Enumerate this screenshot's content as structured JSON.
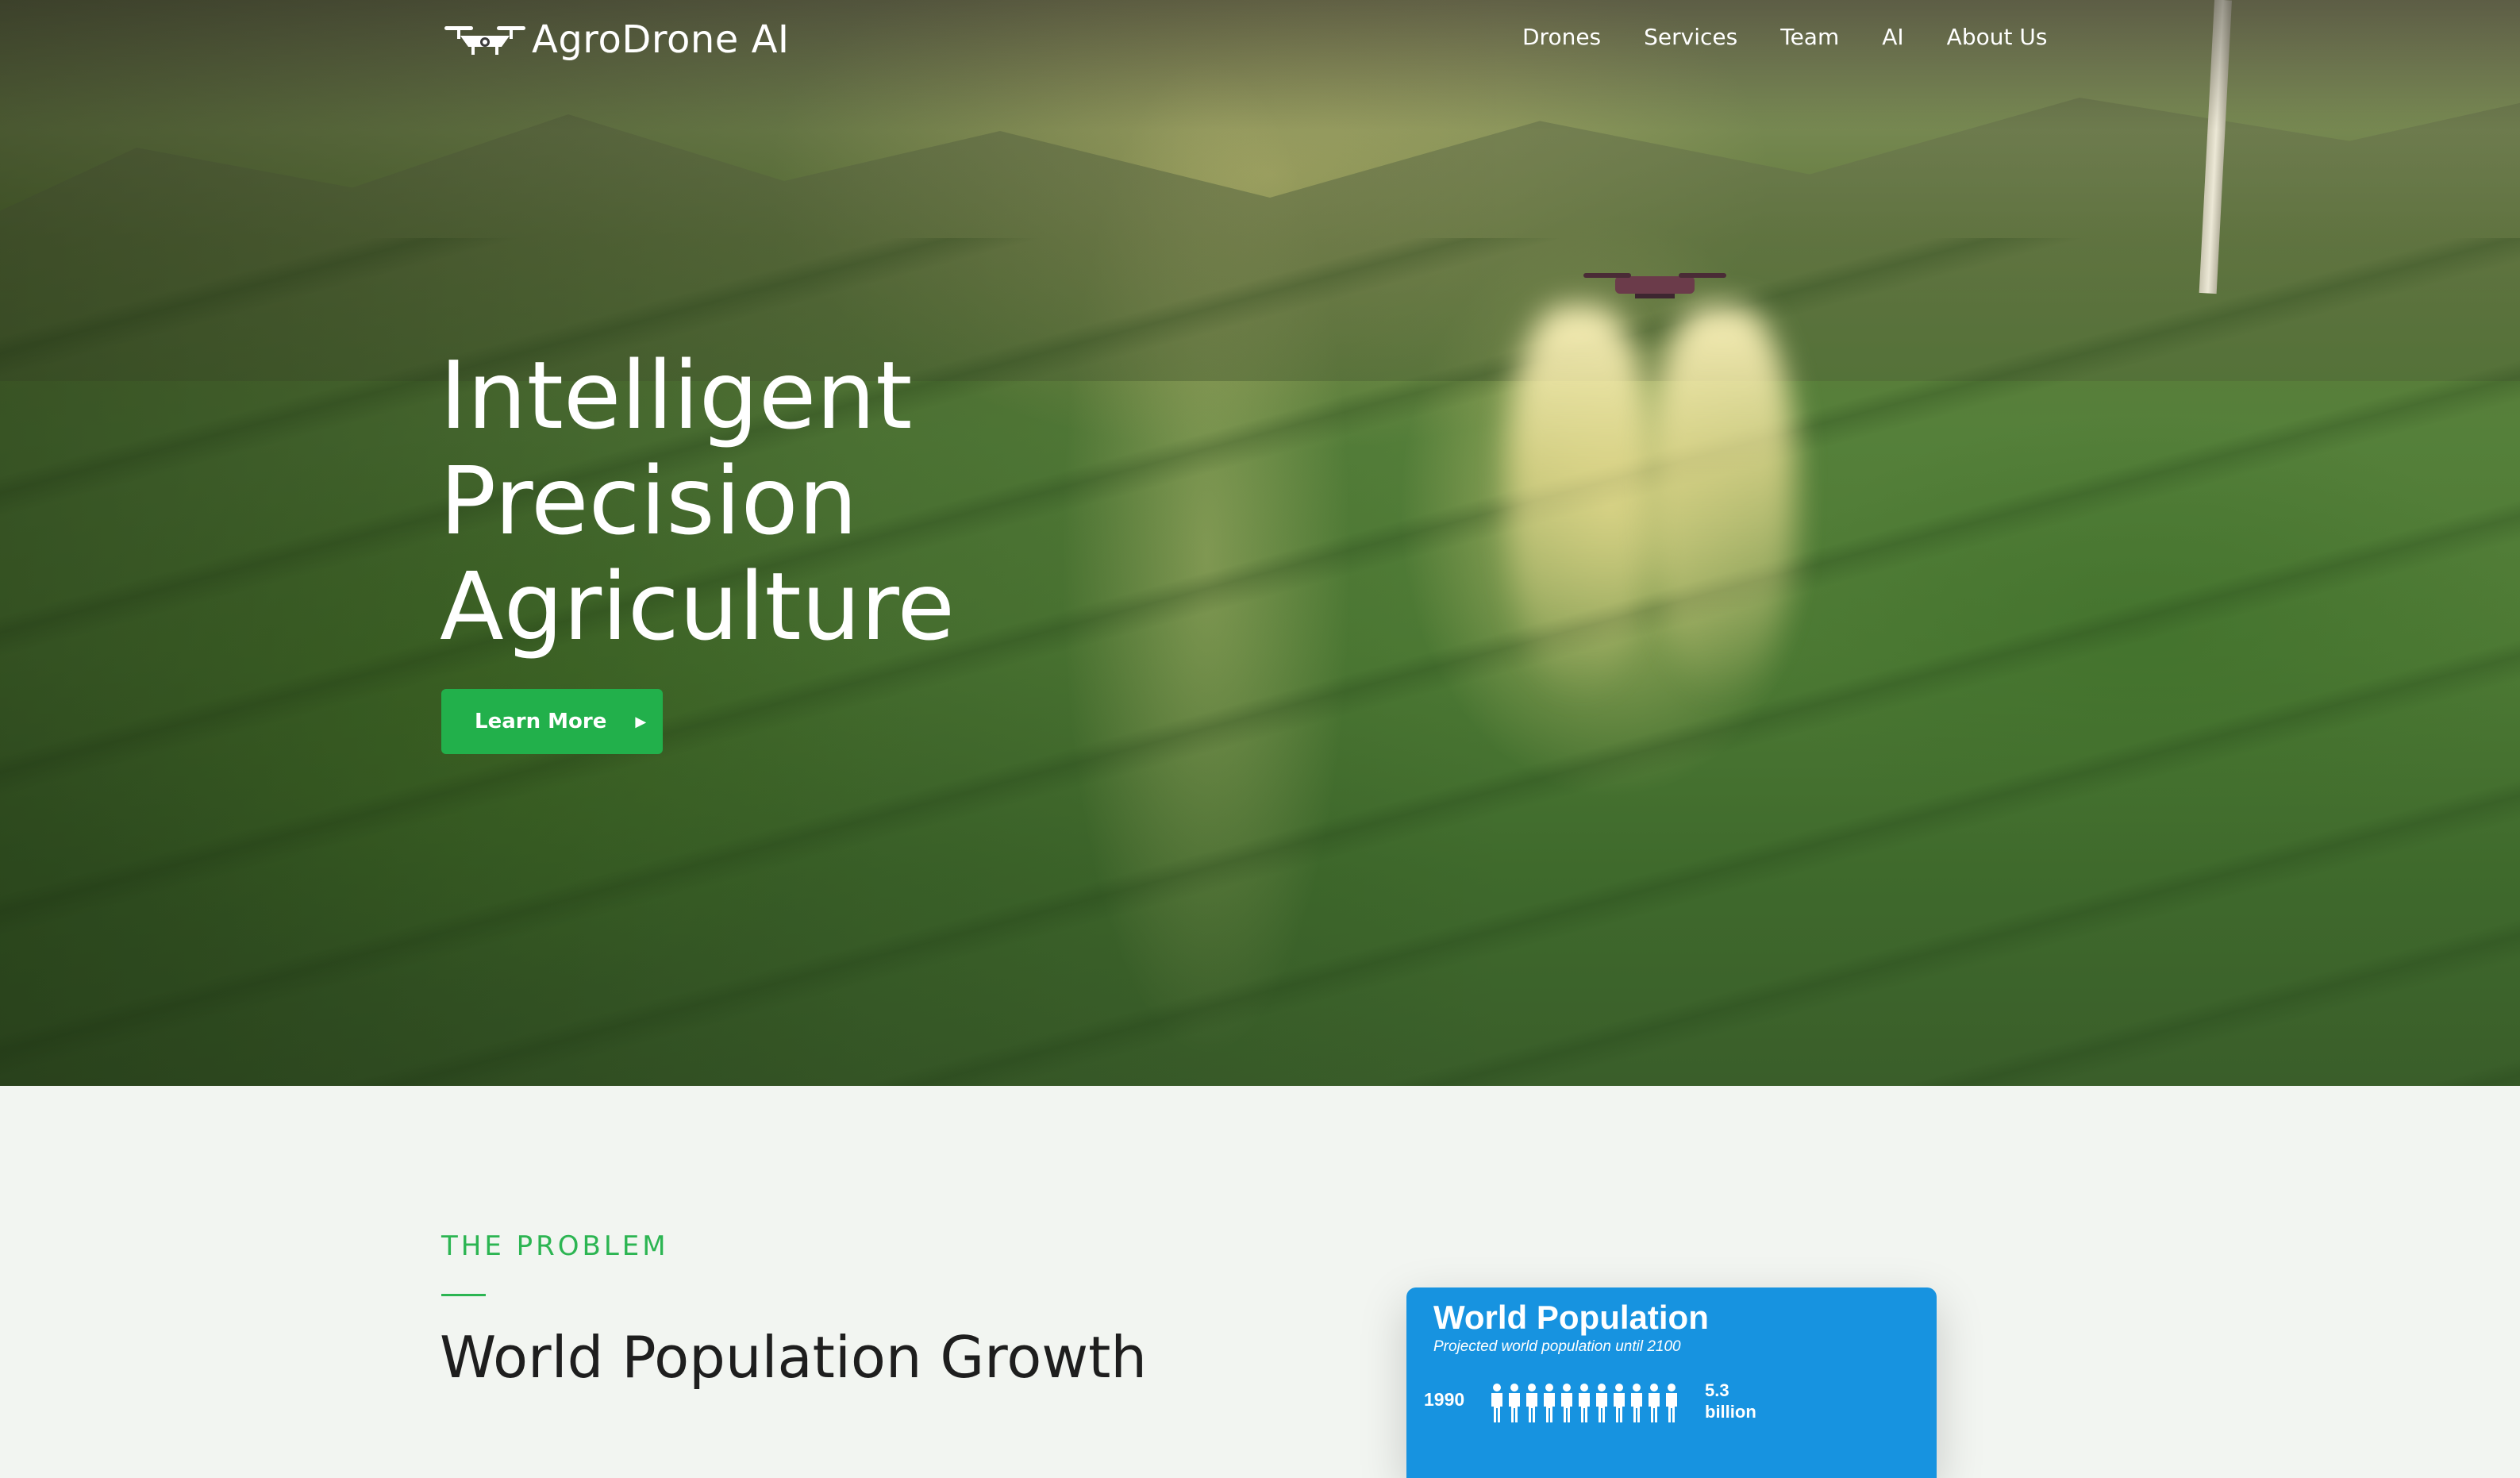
{
  "brand": {
    "name": "AgroDrone AI",
    "logo_icon": "drone-icon"
  },
  "nav": {
    "items": [
      {
        "label": "Drones"
      },
      {
        "label": "Services"
      },
      {
        "label": "Team"
      },
      {
        "label": "AI"
      },
      {
        "label": "About Us"
      }
    ]
  },
  "hero": {
    "title_lines": [
      "Intelligent",
      "Precision",
      "Agriculture"
    ],
    "cta_label": "Learn More",
    "cta_icon": "caret-right-icon"
  },
  "problem": {
    "eyebrow": "THE PROBLEM",
    "title": "World Population Growth"
  },
  "infographic": {
    "title": "World Population",
    "subtitle": "Projected world population until 2100",
    "rows": [
      {
        "year": "1990",
        "value": "5.3",
        "unit": "billion",
        "icon": "person-icon",
        "icon_count": 11
      }
    ]
  },
  "colors": {
    "accent": "#22b04b",
    "eyebrow": "#2cb552",
    "info_bg": "#1793e0",
    "section_bg": "#f2f5f1"
  }
}
